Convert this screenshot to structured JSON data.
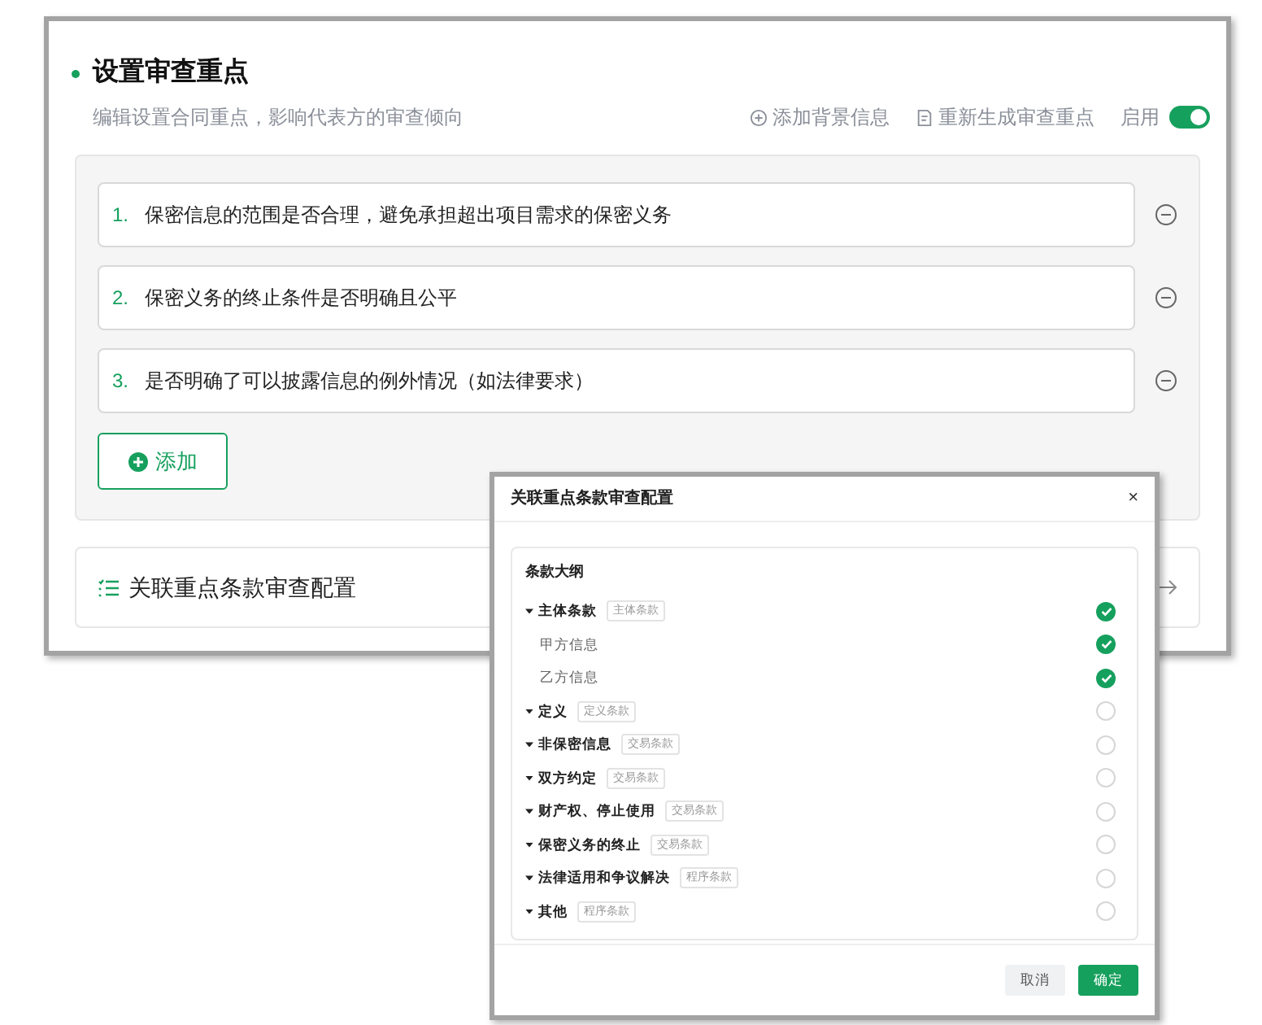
{
  "panel": {
    "title": "设置审查重点",
    "subtitle": "编辑设置合同重点，影响代表方的审查倾向",
    "actions": [
      "添加背景信息",
      "重新生成审查重点"
    ],
    "toggle": {
      "label": "启用",
      "on": true
    },
    "points": [
      {
        "number": "1.",
        "text": "保密信息的范围是否合理，避免承担超出项目需求的保密义务"
      },
      {
        "number": "2.",
        "text": "保密义务的终止条件是否明确且公平"
      },
      {
        "number": "3.",
        "text": "是否明确了可以披露信息的例外情况（如法律要求）"
      }
    ],
    "add_button": "添加",
    "link_card": "关联重点条款审查配置"
  },
  "dialog": {
    "title": "关联重点条款审查配置",
    "close": "×",
    "outline_title": "条款大纲",
    "items": [
      {
        "name": "主体条款",
        "tag": "主体条款",
        "checked": true,
        "children": [
          {
            "name": "甲方信息",
            "checked": true
          },
          {
            "name": "乙方信息",
            "checked": true
          }
        ]
      },
      {
        "name": "定义",
        "tag": "定义条款",
        "checked": false
      },
      {
        "name": "非保密信息",
        "tag": "交易条款",
        "checked": false
      },
      {
        "name": "双方约定",
        "tag": "交易条款",
        "checked": false
      },
      {
        "name": "财产权、停止使用",
        "tag": "交易条款",
        "checked": false
      },
      {
        "name": "保密义务的终止",
        "tag": "交易条款",
        "checked": false
      },
      {
        "name": "法律适用和争议解决",
        "tag": "程序条款",
        "checked": false
      },
      {
        "name": "其他",
        "tag": "程序条款",
        "checked": false
      }
    ],
    "buttons": [
      "取消",
      "确定"
    ]
  }
}
